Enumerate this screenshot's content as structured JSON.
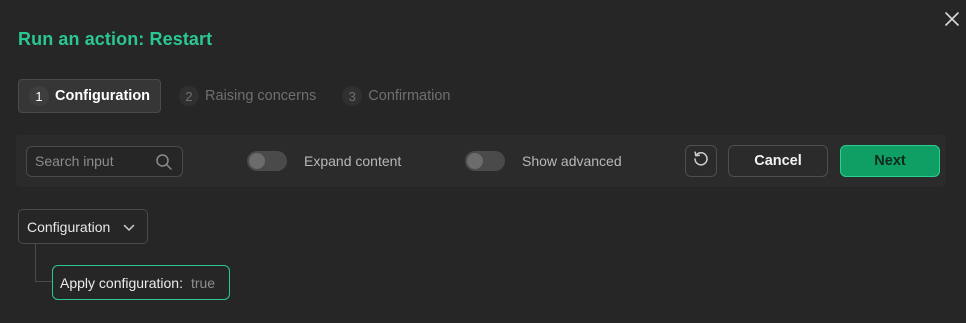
{
  "dialog": {
    "title": "Run an action: Restart"
  },
  "steps": [
    {
      "num": "1",
      "label": "Configuration",
      "active": true
    },
    {
      "num": "2",
      "label": "Raising concerns",
      "active": false
    },
    {
      "num": "3",
      "label": "Confirmation",
      "active": false
    }
  ],
  "toolbar": {
    "search_placeholder": "Search input",
    "search_value": "",
    "expand_label": "Expand content",
    "expand_on": false,
    "advanced_label": "Show advanced",
    "advanced_on": false,
    "cancel_label": "Cancel",
    "next_label": "Next"
  },
  "tree": {
    "root_label": "Configuration",
    "leaf_key": "Apply configuration:",
    "leaf_value": "true"
  },
  "colors": {
    "accent": "#2bc790",
    "primary_button": "#0f9e64",
    "background": "#262626"
  },
  "icons": {
    "close": "close-icon",
    "search": "search-icon",
    "reset": "reset-icon",
    "chevron": "chevron-down-icon"
  }
}
